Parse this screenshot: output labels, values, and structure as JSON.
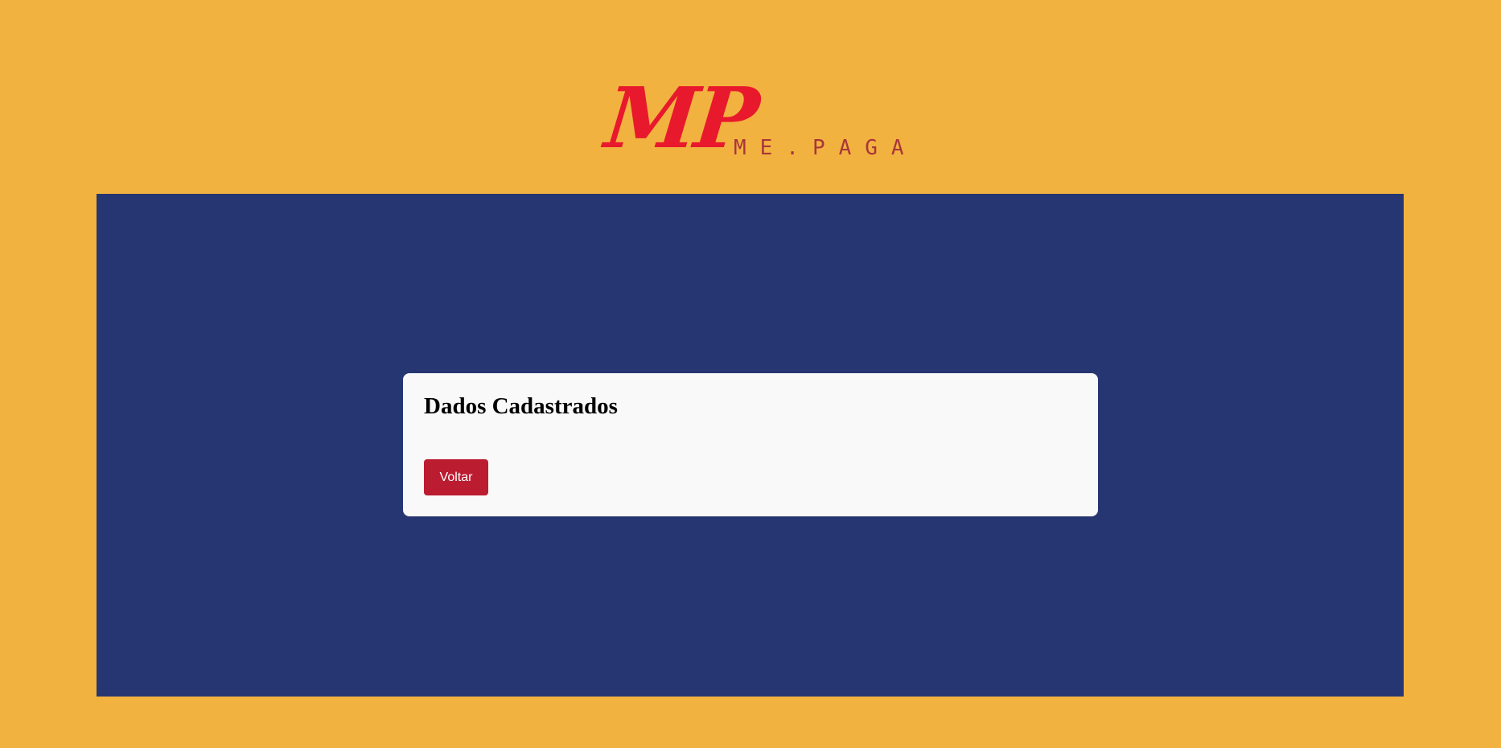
{
  "logo": {
    "mark": "MP",
    "tagline": "ME.PAGA"
  },
  "card": {
    "title": "Dados Cadastrados",
    "back_label": "Voltar"
  },
  "colors": {
    "page_background": "#f2b240",
    "panel_background": "#263672",
    "card_background": "#f9f9f9",
    "button_background": "#bc1c30",
    "logo_red": "#e8192c",
    "tagline_red": "#a8363a"
  }
}
